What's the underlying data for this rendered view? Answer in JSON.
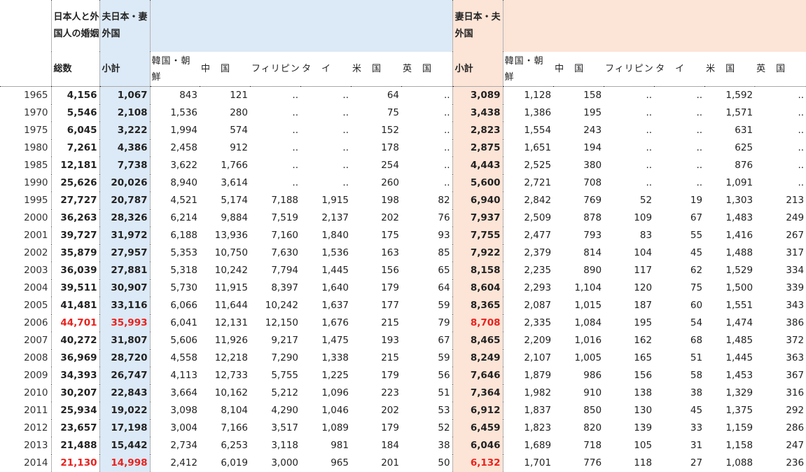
{
  "header": {
    "total_group": "日本人と外国人の婚姻",
    "husband_group": "夫日本・妻外国",
    "wife_group": "妻日本・夫外国",
    "total_label": "総数",
    "subtotal_label": "小計",
    "countries": [
      "韓国・朝鮮",
      "中　国",
      "フィリピン",
      "タ　イ",
      "米　国",
      "英　国"
    ]
  },
  "rows": [
    {
      "year": "1965",
      "total": "4,156",
      "h_sub": "1,067",
      "h": [
        "843",
        "121",
        "..",
        "..",
        "64",
        ".."
      ],
      "w_sub": "3,089",
      "w": [
        "1,128",
        "158",
        "..",
        "..",
        "1,592",
        ".."
      ]
    },
    {
      "year": "1970",
      "total": "5,546",
      "h_sub": "2,108",
      "h": [
        "1,536",
        "280",
        "..",
        "..",
        "75",
        ".."
      ],
      "w_sub": "3,438",
      "w": [
        "1,386",
        "195",
        "..",
        "..",
        "1,571",
        ".."
      ]
    },
    {
      "year": "1975",
      "total": "6,045",
      "h_sub": "3,222",
      "h": [
        "1,994",
        "574",
        "..",
        "..",
        "152",
        ".."
      ],
      "w_sub": "2,823",
      "w": [
        "1,554",
        "243",
        "..",
        "..",
        "631",
        ".."
      ]
    },
    {
      "year": "1980",
      "total": "7,261",
      "h_sub": "4,386",
      "h": [
        "2,458",
        "912",
        "..",
        "..",
        "178",
        ".."
      ],
      "w_sub": "2,875",
      "w": [
        "1,651",
        "194",
        "..",
        "..",
        "625",
        ".."
      ]
    },
    {
      "year": "1985",
      "total": "12,181",
      "h_sub": "7,738",
      "h": [
        "3,622",
        "1,766",
        "..",
        "..",
        "254",
        ".."
      ],
      "w_sub": "4,443",
      "w": [
        "2,525",
        "380",
        "..",
        "..",
        "876",
        ".."
      ]
    },
    {
      "year": "1990",
      "total": "25,626",
      "h_sub": "20,026",
      "h": [
        "8,940",
        "3,614",
        "..",
        "..",
        "260",
        ".."
      ],
      "w_sub": "5,600",
      "w": [
        "2,721",
        "708",
        "..",
        "..",
        "1,091",
        ".."
      ]
    },
    {
      "year": "1995",
      "total": "27,727",
      "h_sub": "20,787",
      "h": [
        "4,521",
        "5,174",
        "7,188",
        "1,915",
        "198",
        "82"
      ],
      "w_sub": "6,940",
      "w": [
        "2,842",
        "769",
        "52",
        "19",
        "1,303",
        "213"
      ]
    },
    {
      "year": "2000",
      "total": "36,263",
      "h_sub": "28,326",
      "h": [
        "6,214",
        "9,884",
        "7,519",
        "2,137",
        "202",
        "76"
      ],
      "w_sub": "7,937",
      "w": [
        "2,509",
        "878",
        "109",
        "67",
        "1,483",
        "249"
      ]
    },
    {
      "year": "2001",
      "total": "39,727",
      "h_sub": "31,972",
      "h": [
        "6,188",
        "13,936",
        "7,160",
        "1,840",
        "175",
        "93"
      ],
      "w_sub": "7,755",
      "w": [
        "2,477",
        "793",
        "83",
        "55",
        "1,416",
        "267"
      ]
    },
    {
      "year": "2002",
      "total": "35,879",
      "h_sub": "27,957",
      "h": [
        "5,353",
        "10,750",
        "7,630",
        "1,536",
        "163",
        "85"
      ],
      "w_sub": "7,922",
      "w": [
        "2,379",
        "814",
        "104",
        "45",
        "1,488",
        "317"
      ]
    },
    {
      "year": "2003",
      "total": "36,039",
      "h_sub": "27,881",
      "h": [
        "5,318",
        "10,242",
        "7,794",
        "1,445",
        "156",
        "65"
      ],
      "w_sub": "8,158",
      "w": [
        "2,235",
        "890",
        "117",
        "62",
        "1,529",
        "334"
      ]
    },
    {
      "year": "2004",
      "total": "39,511",
      "h_sub": "30,907",
      "h": [
        "5,730",
        "11,915",
        "8,397",
        "1,640",
        "179",
        "64"
      ],
      "w_sub": "8,604",
      "w": [
        "2,293",
        "1,104",
        "120",
        "75",
        "1,500",
        "339"
      ]
    },
    {
      "year": "2005",
      "total": "41,481",
      "h_sub": "33,116",
      "h": [
        "6,066",
        "11,644",
        "10,242",
        "1,637",
        "177",
        "59"
      ],
      "w_sub": "8,365",
      "w": [
        "2,087",
        "1,015",
        "187",
        "60",
        "1,551",
        "343"
      ]
    },
    {
      "year": "2006",
      "total": "44,701",
      "h_sub": "35,993",
      "h": [
        "6,041",
        "12,131",
        "12,150",
        "1,676",
        "215",
        "79"
      ],
      "w_sub": "8,708",
      "w": [
        "2,335",
        "1,084",
        "195",
        "54",
        "1,474",
        "386"
      ],
      "highlight": true
    },
    {
      "year": "2007",
      "total": "40,272",
      "h_sub": "31,807",
      "h": [
        "5,606",
        "11,926",
        "9,217",
        "1,475",
        "193",
        "67"
      ],
      "w_sub": "8,465",
      "w": [
        "2,209",
        "1,016",
        "162",
        "68",
        "1,485",
        "372"
      ]
    },
    {
      "year": "2008",
      "total": "36,969",
      "h_sub": "28,720",
      "h": [
        "4,558",
        "12,218",
        "7,290",
        "1,338",
        "215",
        "59"
      ],
      "w_sub": "8,249",
      "w": [
        "2,107",
        "1,005",
        "165",
        "51",
        "1,445",
        "363"
      ]
    },
    {
      "year": "2009",
      "total": "34,393",
      "h_sub": "26,747",
      "h": [
        "4,113",
        "12,733",
        "5,755",
        "1,225",
        "179",
        "56"
      ],
      "w_sub": "7,646",
      "w": [
        "1,879",
        "986",
        "156",
        "58",
        "1,453",
        "367"
      ]
    },
    {
      "year": "2010",
      "total": "30,207",
      "h_sub": "22,843",
      "h": [
        "3,664",
        "10,162",
        "5,212",
        "1,096",
        "223",
        "51"
      ],
      "w_sub": "7,364",
      "w": [
        "1,982",
        "910",
        "138",
        "38",
        "1,329",
        "316"
      ]
    },
    {
      "year": "2011",
      "total": "25,934",
      "h_sub": "19,022",
      "h": [
        "3,098",
        "8,104",
        "4,290",
        "1,046",
        "202",
        "53"
      ],
      "w_sub": "6,912",
      "w": [
        "1,837",
        "850",
        "130",
        "45",
        "1,375",
        "292"
      ]
    },
    {
      "year": "2012",
      "total": "23,657",
      "h_sub": "17,198",
      "h": [
        "3,004",
        "7,166",
        "3,517",
        "1,089",
        "179",
        "52"
      ],
      "w_sub": "6,459",
      "w": [
        "1,823",
        "820",
        "139",
        "33",
        "1,159",
        "286"
      ]
    },
    {
      "year": "2013",
      "total": "21,488",
      "h_sub": "15,442",
      "h": [
        "2,734",
        "6,253",
        "3,118",
        "981",
        "184",
        "38"
      ],
      "w_sub": "6,046",
      "w": [
        "1,689",
        "718",
        "105",
        "31",
        "1,158",
        "247"
      ]
    },
    {
      "year": "2014",
      "total": "21,130",
      "h_sub": "14,998",
      "h": [
        "2,412",
        "6,019",
        "3,000",
        "965",
        "201",
        "50"
      ],
      "w_sub": "6,132",
      "w": [
        "1,701",
        "776",
        "118",
        "27",
        "1,088",
        "236"
      ],
      "highlight": true
    }
  ],
  "colors": {
    "husband_header": "#dce9f6",
    "wife_header": "#fce4d6",
    "highlight": "#e8231f"
  }
}
